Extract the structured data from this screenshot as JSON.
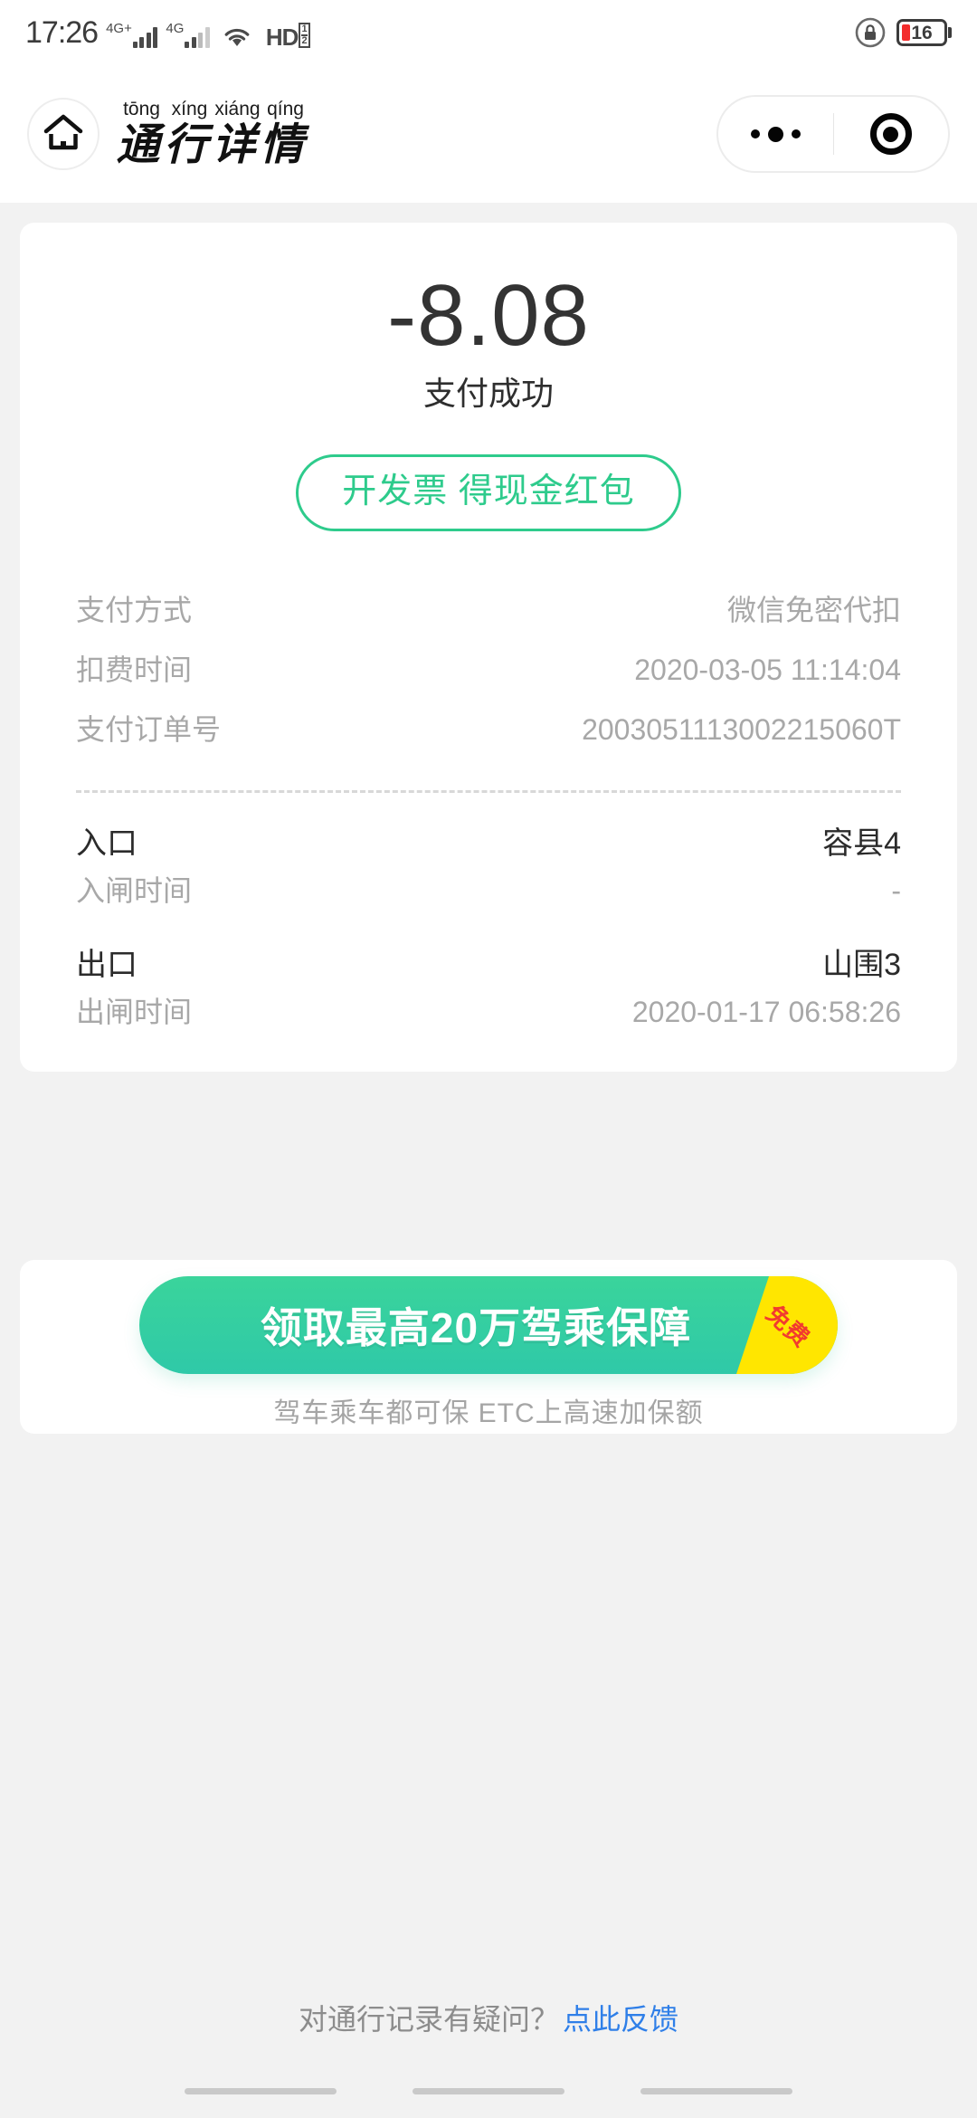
{
  "status_bar": {
    "time": "17:26",
    "network_primary": "4G+",
    "network_secondary": "4G",
    "wifi_icon": "wifi-icon",
    "volte_label": "HD",
    "volte_sim": [
      "1",
      "2"
    ],
    "lock_icon": "rotation-lock-icon",
    "battery_level": "16"
  },
  "header": {
    "home_icon": "home-icon",
    "pinyin": [
      "tōng",
      "xíng",
      "xiáng",
      "qíng"
    ],
    "title_chars": [
      "通",
      "行",
      "详",
      "情"
    ],
    "title": "通行详情",
    "menu_icon": "more-dots-icon",
    "close_icon": "target-close-icon"
  },
  "payment": {
    "amount": "-8.08",
    "status": "支付成功",
    "invoice_button": "开发票 得现金红包",
    "details": [
      {
        "label": "支付方式",
        "value": "微信免密代扣"
      },
      {
        "label": "扣费时间",
        "value": "2020-03-05 11:14:04"
      },
      {
        "label": "支付订单号",
        "value": "2003051113002215060T"
      }
    ],
    "entrance": {
      "label": "入口",
      "value": "容县4"
    },
    "entrance_time": {
      "label": "入闸时间",
      "value": "-"
    },
    "exit": {
      "label": "出口",
      "value": "山围3"
    },
    "exit_time": {
      "label": "出闸时间",
      "value": "2020-01-17 06:58:26"
    }
  },
  "ad": {
    "banner_text": "领取最高20万驾乘保障",
    "ribbon_text": "免费",
    "subtitle": "驾车乘车都可保  ETC上高速加保额"
  },
  "footer": {
    "question": "对通行记录有疑问？",
    "link": "点此反馈"
  },
  "colors": {
    "accent_green": "#2ecb8c",
    "banner_green": "#33d09f",
    "ribbon_yellow": "#ffe600",
    "ribbon_red": "#f23b2f",
    "link_blue": "#2f7fe8",
    "battery_red": "#f32d2d"
  }
}
